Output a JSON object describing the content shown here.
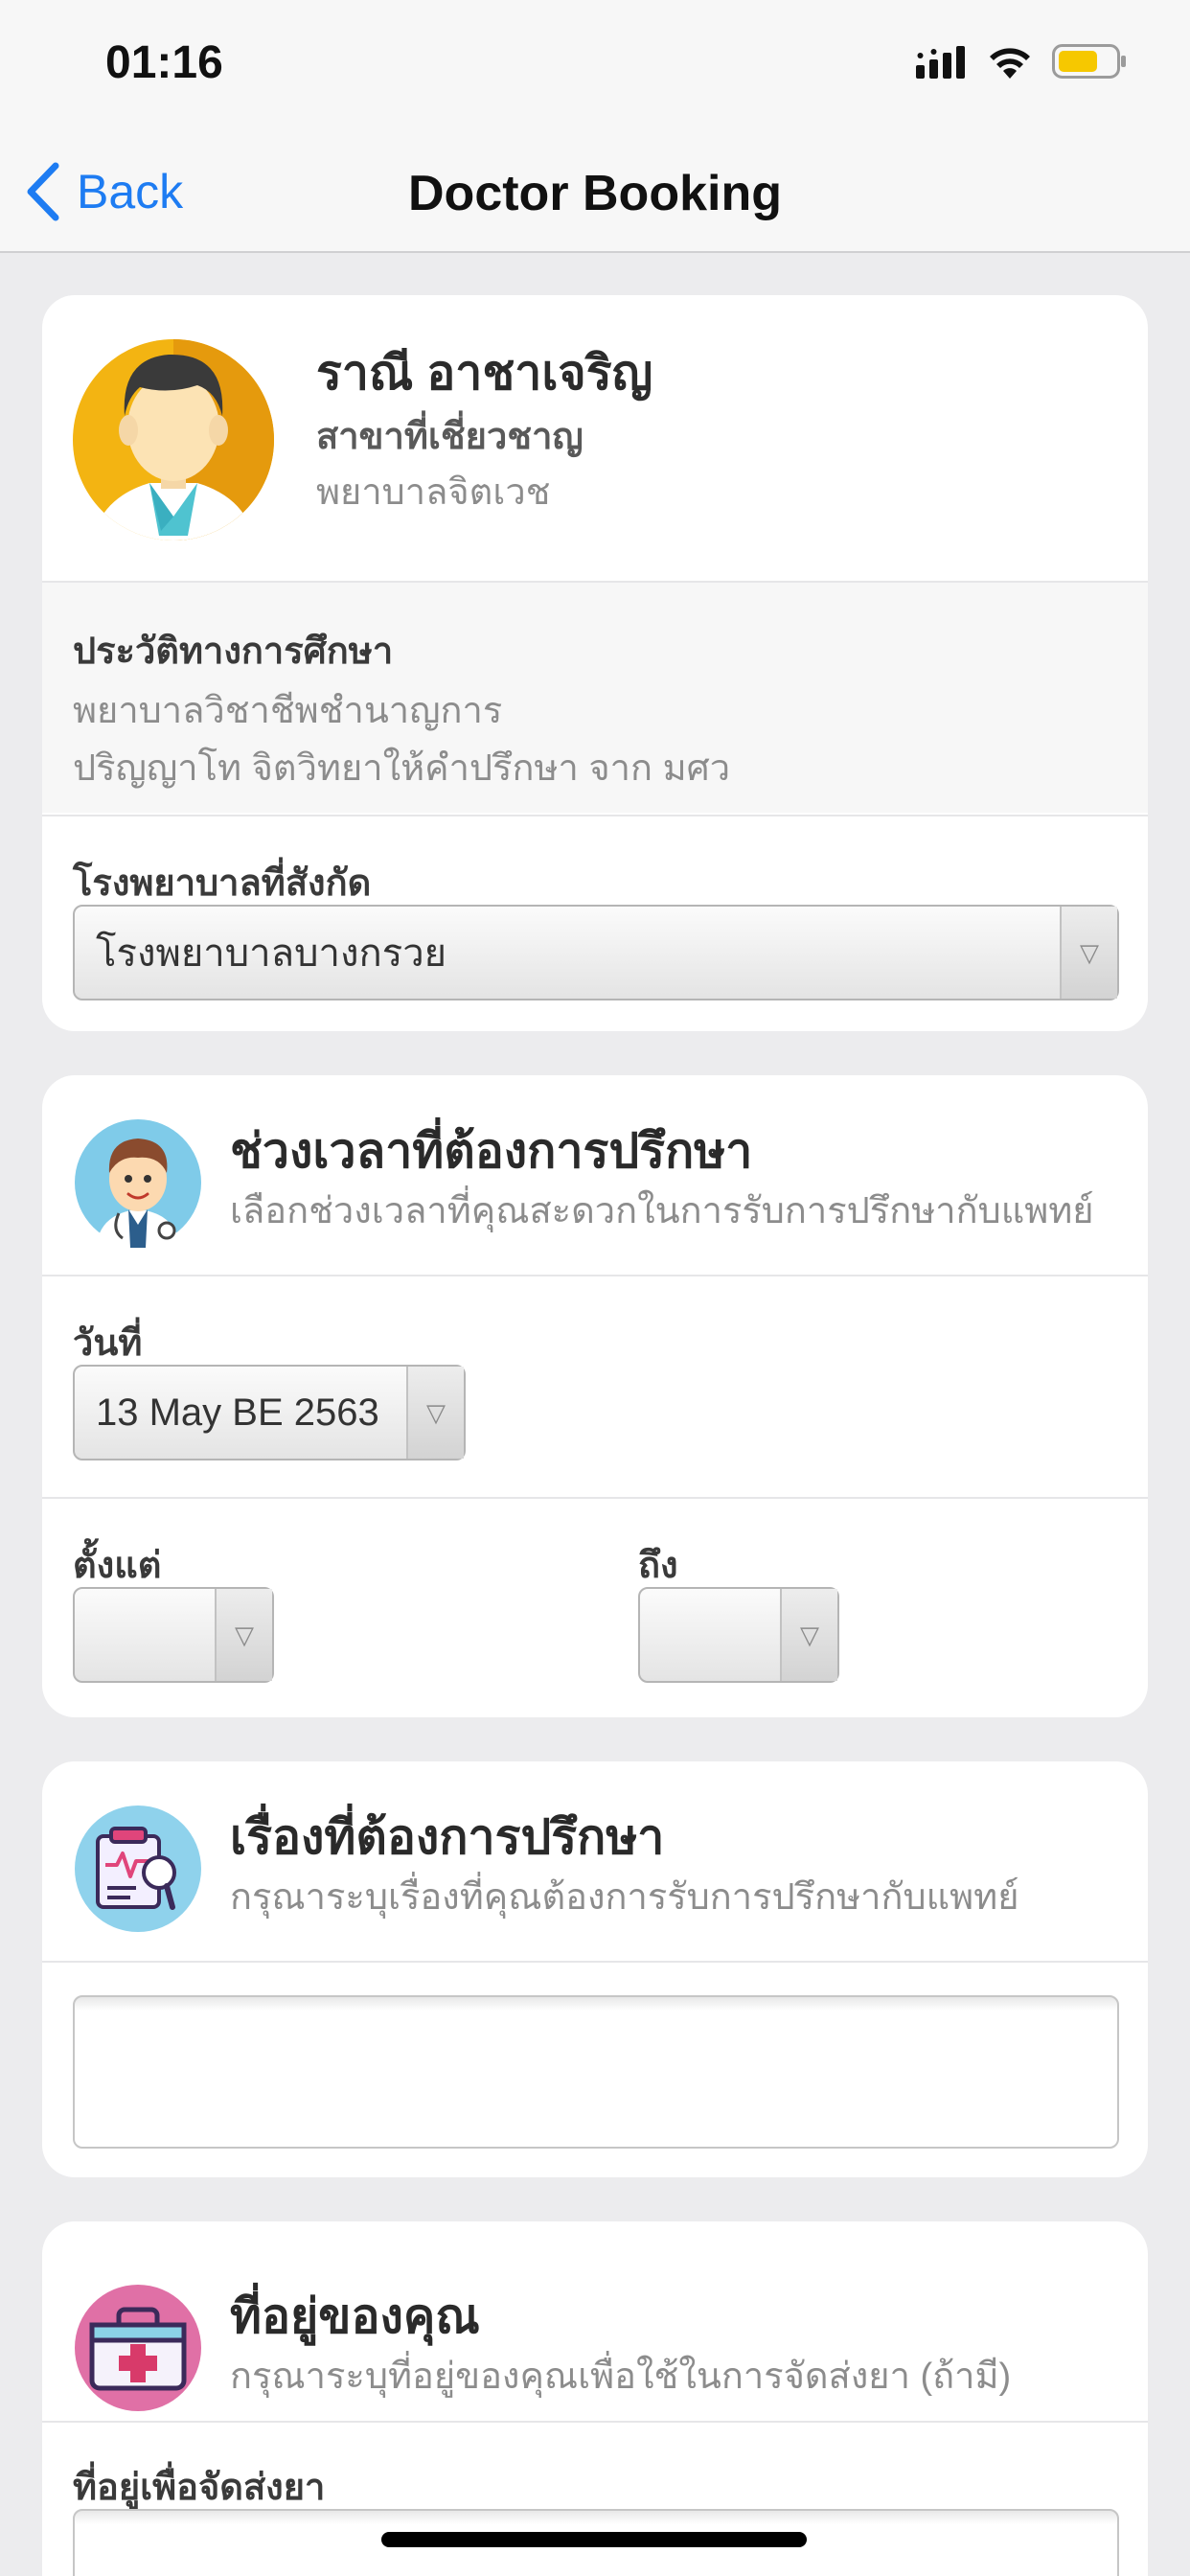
{
  "status_bar": {
    "time": "01:16"
  },
  "nav": {
    "back_label": "Back",
    "title": "Doctor Booking"
  },
  "doctor": {
    "name": "ราณี อาชาเจริญ",
    "specialty_label": "สาขาที่เชี่ยวชาญ",
    "specialty": "พยาบาลจิตเวช",
    "education_label": "ประวัติทางการศึกษา",
    "education": [
      "พยาบาลวิชาชีพชำนาญการ",
      "ปริญญาโท จิตวิทยาให้คำปรึกษา จาก มศว"
    ],
    "hospital_label": "โรงพยาบาลที่สังกัด",
    "hospital_value": "โรงพยาบาลบางกรวย"
  },
  "time_section": {
    "title": "ช่วงเวลาที่ต้องการปรึกษา",
    "subtitle": "เลือกช่วงเวลาที่คุณสะดวกในการรับการปรึกษากับแพทย์",
    "date_label": "วันที่",
    "date_value": "13 May BE 2563",
    "from_label": "ตั้งแต่",
    "from_value": "",
    "to_label": "ถึง",
    "to_value": ""
  },
  "topic_section": {
    "title": "เรื่องที่ต้องการปรึกษา",
    "subtitle": "กรุณาระบุเรื่องที่คุณต้องการรับการปรึกษากับแพทย์",
    "value": ""
  },
  "address_section": {
    "title": "ที่อยู่ของคุณ",
    "subtitle": "กรุณาระบุที่อยู่ของคุณเพื่อใช้ในการจัดส่งยา (ถ้ามี)",
    "field_label": "ที่อยู่เพื่อจัดส่งยา",
    "value": ""
  },
  "icons": {
    "back": "chevron-left-icon",
    "dropdown": "triangle-down-icon",
    "signal": "cellular-signal-icon",
    "wifi": "wifi-icon",
    "battery": "battery-icon"
  },
  "colors": {
    "accent": "#1E7CF2",
    "battery_fill": "#F6C800",
    "background": "#ECECEE"
  }
}
